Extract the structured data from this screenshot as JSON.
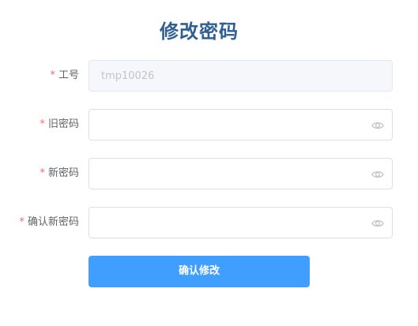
{
  "page": {
    "title": "修改密码"
  },
  "form": {
    "required_mark": "*",
    "fields": [
      {
        "label": "工号",
        "value": "tmp10026",
        "disabled": true
      },
      {
        "label": "旧密码",
        "value": "",
        "placeholder": "",
        "icon": "eye-icon"
      },
      {
        "label": "新密码",
        "value": "",
        "placeholder": "",
        "icon": "eye-icon"
      },
      {
        "label": "确认新密码",
        "value": "",
        "placeholder": "",
        "icon": "eye-icon"
      }
    ],
    "submit_label": "确认修改"
  },
  "colors": {
    "title": "#2f5f93",
    "required": "#f56c6c",
    "primary_button": "#409eff",
    "disabled_input_bg": "#f5f7fa",
    "input_border": "#dcdfe6"
  }
}
